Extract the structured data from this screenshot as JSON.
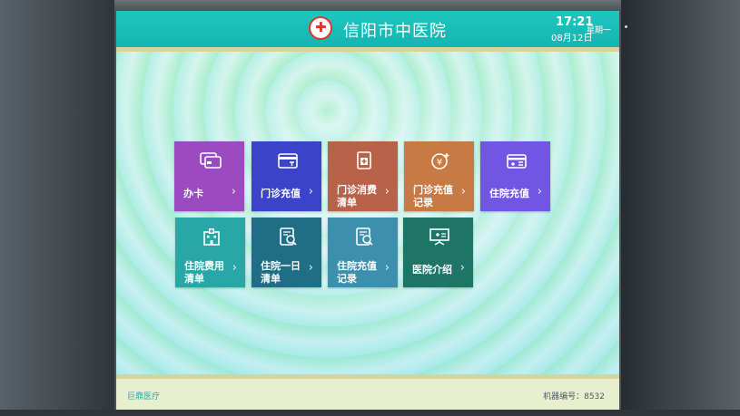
{
  "header": {
    "hospital_name": "信阳市中医院",
    "time": "17:21",
    "date": "08月12日",
    "weekday": "星期一"
  },
  "tiles": [
    {
      "label": "办卡",
      "icon": "card-icon"
    },
    {
      "label": "门诊充值",
      "icon": "recharge-card-icon"
    },
    {
      "label": "门诊消费清单",
      "icon": "medical-record-icon"
    },
    {
      "label": "门诊充值记录",
      "icon": "yuan-add-icon"
    },
    {
      "label": "住院充值",
      "icon": "inpatient-card-icon"
    },
    {
      "label": "住院费用清单",
      "icon": "hospital-building-icon"
    },
    {
      "label": "住院一日清单",
      "icon": "daily-report-icon"
    },
    {
      "label": "住院充值记录",
      "icon": "recharge-record-icon"
    },
    {
      "label": "医院介绍",
      "icon": "presentation-board-icon"
    }
  ],
  "footer": {
    "vendor": "巨鼎医疗",
    "machine_number": "机器编号：8532"
  },
  "colors": {
    "header_teal": "#1ec6c0",
    "accent_stripe": "#d8d396"
  }
}
